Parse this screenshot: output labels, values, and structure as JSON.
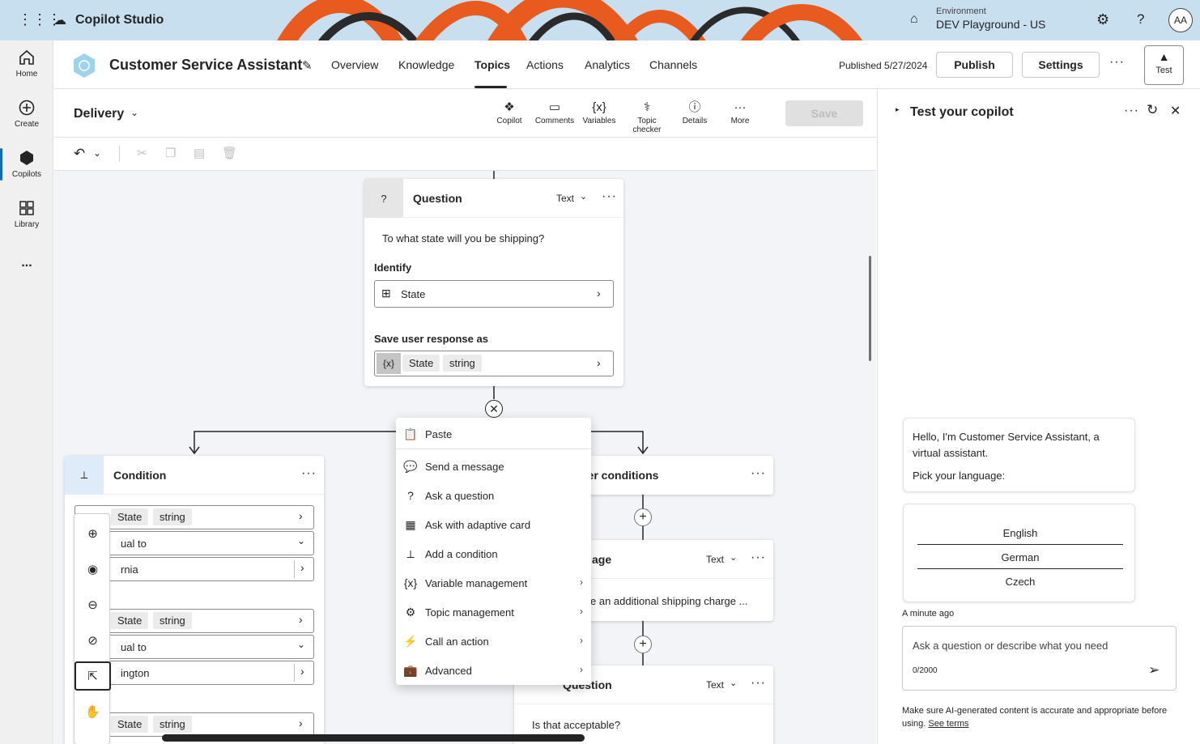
{
  "topbar": {
    "app_title": "Copilot Studio",
    "environment_label": "Environment",
    "environment_value": "DEV Playground - US",
    "avatar_initials": "AA"
  },
  "rail": {
    "items": [
      {
        "label": "Home",
        "icon": "home-icon"
      },
      {
        "label": "Create",
        "icon": "plus-circle-icon"
      },
      {
        "label": "Copilots",
        "icon": "copilot-icon"
      },
      {
        "label": "Library",
        "icon": "library-icon"
      }
    ],
    "more": "..."
  },
  "header": {
    "app_name": "Customer Service Assistant",
    "tabs": [
      "Overview",
      "Knowledge",
      "Topics",
      "Actions",
      "Analytics",
      "Channels"
    ],
    "active_tab": "Topics",
    "published": "Published 5/27/2024",
    "publish_label": "Publish",
    "settings_label": "Settings",
    "test_label": "Test"
  },
  "toolbar": {
    "topic_name": "Delivery",
    "tools": [
      "Copilot",
      "Comments",
      "Variables",
      "Topic checker",
      "Details",
      "More"
    ],
    "save_label": "Save"
  },
  "question_node": {
    "title": "Question",
    "type_label": "Text",
    "prompt": "To what state will you be shipping?",
    "identify_label": "Identify",
    "identify_value": "State",
    "save_label": "Save user response as",
    "var_badge": "{x}",
    "var_name": "State",
    "var_type": "string"
  },
  "condition_node": {
    "title": "Condition",
    "rows": [
      {
        "var": "State",
        "type": "string",
        "op": "ual to",
        "value": "rnia"
      },
      {
        "var": "State",
        "type": "string",
        "op": "ual to",
        "value": "ington"
      },
      {
        "var": "State",
        "type": "string"
      }
    ]
  },
  "other_conditions_node": {
    "title": "her conditions"
  },
  "message_node": {
    "title": "age",
    "type_label": "Text",
    "text": "e an additional shipping charge ..."
  },
  "question_node_2": {
    "title": "Question",
    "type_label": "Text",
    "prompt": "Is that acceptable?"
  },
  "context_menu": {
    "items": [
      {
        "label": "Paste",
        "icon": "paste-icon",
        "submenu": false
      },
      {
        "label": "Send a message",
        "icon": "message-icon",
        "submenu": false
      },
      {
        "label": "Ask a question",
        "icon": "question-icon",
        "submenu": false
      },
      {
        "label": "Ask with adaptive card",
        "icon": "card-icon",
        "submenu": false
      },
      {
        "label": "Add a condition",
        "icon": "condition-icon",
        "submenu": false
      },
      {
        "label": "Variable management",
        "icon": "variable-icon",
        "submenu": true
      },
      {
        "label": "Topic management",
        "icon": "topic-icon",
        "submenu": true
      },
      {
        "label": "Call an action",
        "icon": "action-icon",
        "submenu": true
      },
      {
        "label": "Advanced",
        "icon": "briefcase-icon",
        "submenu": true
      }
    ]
  },
  "test_panel": {
    "title": "Test your copilot",
    "greeting_line1": "Hello, I'm Customer Service Assistant, a virtual assistant.",
    "greeting_line2": "Pick your language:",
    "languages": [
      "English",
      "German",
      "Czech"
    ],
    "timestamp": "A minute ago",
    "input_placeholder": "Ask a question or describe what you need",
    "char_count": "0/2000",
    "disclaimer": "Make sure AI-generated content is accurate and appropriate before using.",
    "terms_link": "See terms"
  },
  "colors": {
    "accent": "#0f6cbd",
    "topbar": "#c8dff0",
    "canvas": "#f2f4f8"
  }
}
